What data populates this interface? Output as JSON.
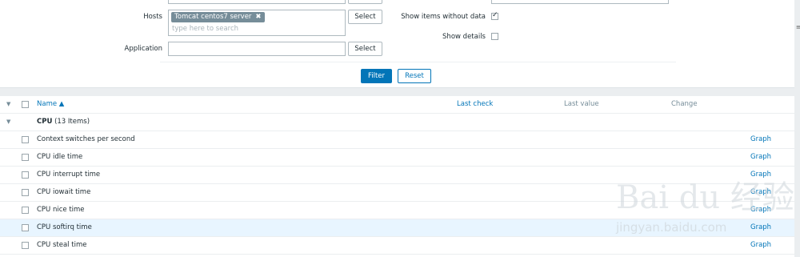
{
  "filter": {
    "hosts_label": "Hosts",
    "host_tag": "Tomcat centos7 server",
    "host_tag_remove": "✖",
    "hosts_placeholder": "type here to search",
    "select_label": "Select",
    "application_label": "Application",
    "application_value": "",
    "show_without_data_label": "Show items without data",
    "show_without_data_checked": true,
    "show_details_label": "Show details",
    "show_details_checked": false,
    "filter_button": "Filter",
    "reset_button": "Reset"
  },
  "table": {
    "headers": {
      "name": "Name ▲",
      "last_check": "Last check",
      "last_value": "Last value",
      "change": "Change"
    },
    "group": {
      "name": "CPU",
      "count": "(13 Items)"
    },
    "rows": [
      {
        "name": "Context switches per second",
        "action": "Graph"
      },
      {
        "name": "CPU idle time",
        "action": "Graph"
      },
      {
        "name": "CPU interrupt time",
        "action": "Graph"
      },
      {
        "name": "CPU iowait time",
        "action": "Graph"
      },
      {
        "name": "CPU nice time",
        "action": "Graph"
      },
      {
        "name": "CPU softirq time",
        "action": "Graph"
      },
      {
        "name": "CPU steal time",
        "action": "Graph"
      }
    ]
  },
  "watermark": {
    "logo": "Bai du 经验",
    "url": "jingyan.baidu.com"
  },
  "colors": {
    "accent": "#0275b8",
    "row_highlight": "#e8f5ff"
  }
}
